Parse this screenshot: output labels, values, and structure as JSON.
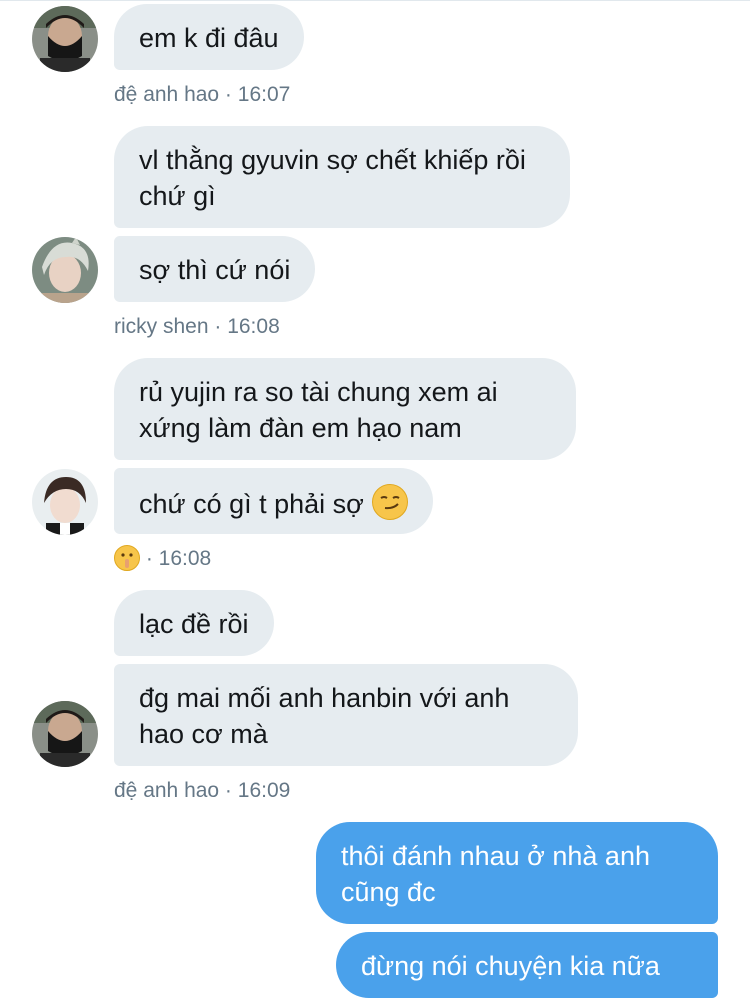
{
  "messages": [
    {
      "id": "m1",
      "text": "em k đi đâu"
    },
    {
      "id": "m2",
      "text": "vl thằng gyuvin sợ chết khiếp rồi chứ gì"
    },
    {
      "id": "m3",
      "text": "sợ thì cứ nói"
    },
    {
      "id": "m4",
      "text": "rủ yujin ra so tài chung xem ai xứng làm đàn em hạo nam"
    },
    {
      "id": "m5",
      "text": "chứ có gì t phải sợ"
    },
    {
      "id": "m6",
      "text": "lạc đề rồi"
    },
    {
      "id": "m7",
      "text": "đg mai mối anh hanbin với anh hao cơ mà"
    },
    {
      "id": "m8",
      "text": "thôi đánh nhau ở nhà anh cũng đc"
    },
    {
      "id": "m9",
      "text": "đừng nói chuyện kia nữa"
    }
  ],
  "meta": {
    "group1": "đệ anh hao · 16:07",
    "group2": "ricky shen · 16:08",
    "group3": "· 16:08",
    "group4": "đệ anh hao · 16:09"
  },
  "icons": {
    "smirk": "smirking-face-emoji",
    "shush": "shushing-face-emoji"
  },
  "colors": {
    "received_bubble": "#e6ecf0",
    "sent_bubble": "#4aa1eb",
    "meta_text": "#657786"
  }
}
